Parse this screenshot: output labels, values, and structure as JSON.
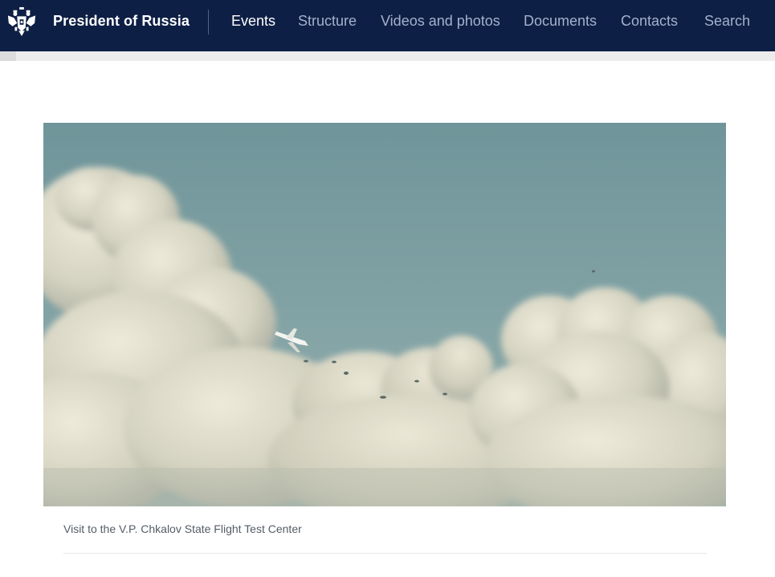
{
  "header": {
    "site_title": "President of Russia",
    "emblem_icon": "double-headed-eagle-icon",
    "nav": [
      {
        "label": "Events",
        "active": true
      },
      {
        "label": "Structure",
        "active": false
      },
      {
        "label": "Videos and photos",
        "active": false
      },
      {
        "label": "Documents",
        "active": false
      },
      {
        "label": "Contacts",
        "active": false
      },
      {
        "label": "Search",
        "active": false
      }
    ]
  },
  "colors": {
    "header_bg": "#0e1f45",
    "nav_inactive": "#a3b1cd",
    "nav_active": "#ffffff",
    "sky": "#7d9ea2",
    "caption_text": "#555c66"
  },
  "media": {
    "caption": "Visit to the V.P. Chkalov State Flight Test Center"
  }
}
